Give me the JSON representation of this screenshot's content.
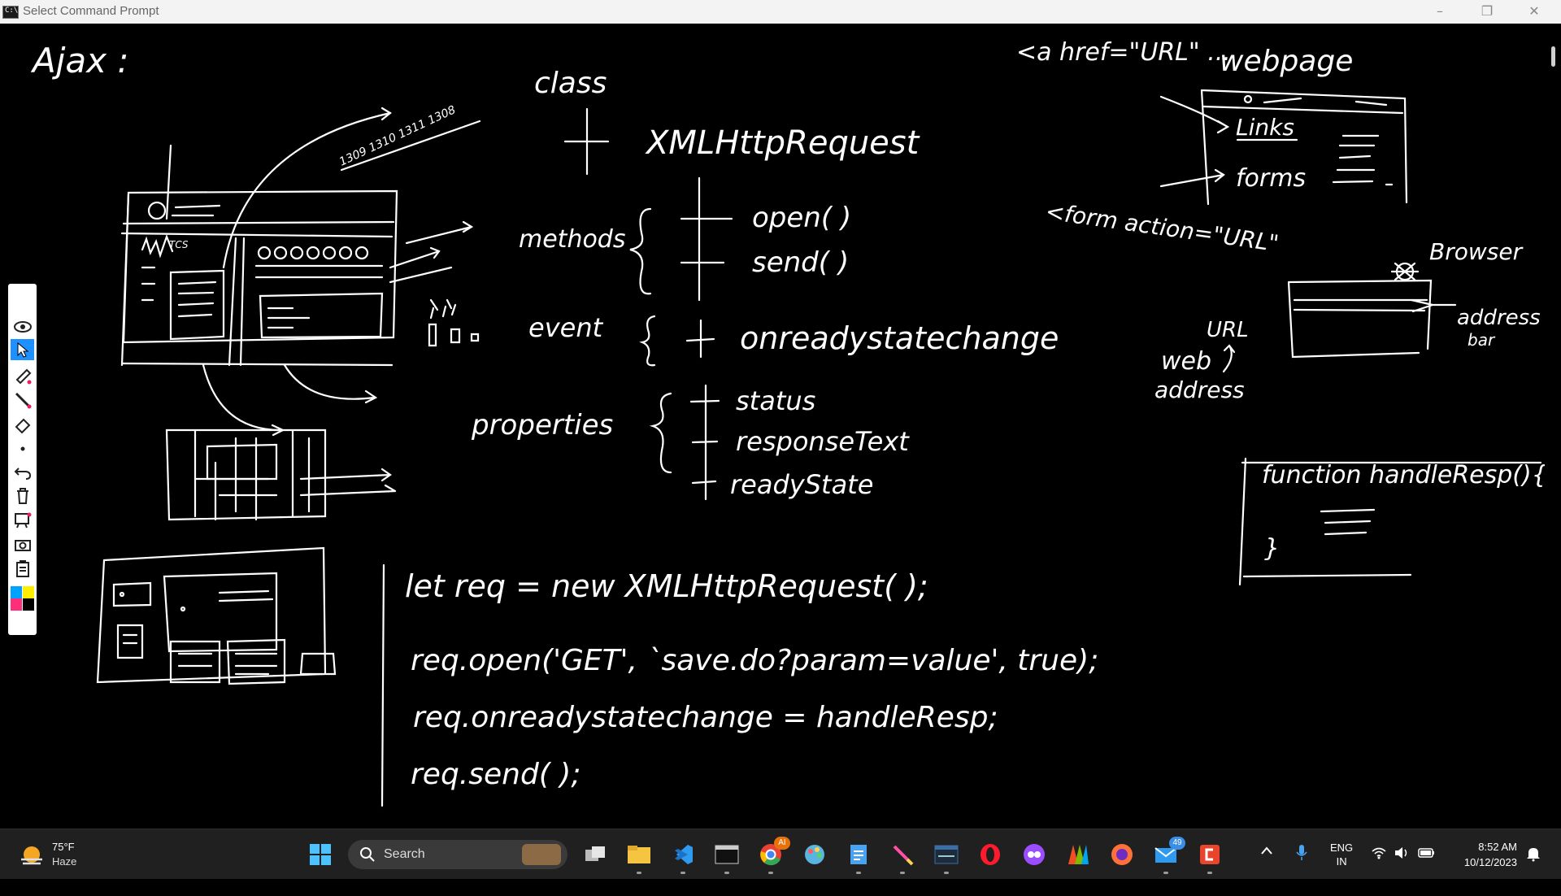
{
  "window": {
    "title": "Select Command Prompt",
    "icon_label": "C:\\",
    "buttons": [
      "minimize-icon",
      "restore-icon",
      "close-icon"
    ]
  },
  "whiteboard": {
    "heading": "Ajax :",
    "class_label": "class",
    "class_name": "XMLHttpRequest",
    "methods_label": "methods",
    "methods": [
      "open( )",
      "send( )"
    ],
    "event_label": "event",
    "event": "onreadystatechange",
    "properties_label": "properties",
    "properties": [
      "status",
      "responseText",
      "readyState"
    ],
    "code": [
      "let req  =  new  XMLHttpRequest( );",
      "req.open('GET',  `save.do?param=value',  true);",
      "req.onreadystatechange  =  handleResp;",
      "req.send( );"
    ],
    "anchor_tag": "<a href=\"URL\" ...",
    "webpage_label": "webpage",
    "links_label": "Links",
    "forms_label": "forms",
    "form_tag": "<form action=\"URL\"",
    "browser_label": "Browser",
    "url_label": "URL",
    "web_address_label": [
      "web",
      "address"
    ],
    "address_bar_label": [
      "address",
      "bar"
    ],
    "function_text": "function handleResp(){",
    "function_close": "}",
    "sketch_numbers": "1309 1310 1311 1308",
    "sketch_tcs": "TCS"
  },
  "toolbar": {
    "tools": [
      "pen-icon",
      "eye-icon",
      "pointer-icon",
      "highlighter-icon",
      "line-icon",
      "eraser-icon",
      "dot-icon",
      "undo-icon",
      "trash-icon",
      "whiteboard-icon",
      "camera-icon",
      "clipboard-icon",
      "color-palette-icon"
    ],
    "selected": "pointer-icon",
    "palette": [
      "#00a2ff",
      "#ffee00",
      "#ff2e7a",
      "#000000"
    ]
  },
  "taskbar": {
    "weather": {
      "temp": "75°F",
      "condition": "Haze"
    },
    "search_placeholder": "Search",
    "apps": [
      {
        "name": "start",
        "color": "#4cc2ff"
      },
      {
        "name": "task-view",
        "color": "#cfcfcf"
      },
      {
        "name": "file-explorer",
        "color": "#f5c542"
      },
      {
        "name": "vscode",
        "color": "#2f9bf0"
      },
      {
        "name": "terminal",
        "color": "#e0e0e0"
      },
      {
        "name": "chrome",
        "color": "#e94235"
      },
      {
        "name": "paint",
        "color": "#59b4e0"
      },
      {
        "name": "notepad",
        "color": "#4aa3f0"
      },
      {
        "name": "pen-tool",
        "color": "#ff4fa3"
      },
      {
        "name": "mysql",
        "color": "#3a6ea5"
      },
      {
        "name": "opera",
        "color": "#ff1b2d"
      },
      {
        "name": "app-purple",
        "color": "#9b4dff"
      },
      {
        "name": "app-colorful",
        "color": "#f25022"
      },
      {
        "name": "firefox",
        "color": "#ff7139"
      },
      {
        "name": "mail",
        "color": "#2f9bf0"
      },
      {
        "name": "app-red",
        "color": "#e8452c"
      }
    ],
    "chrome_badge": "AI",
    "mail_badge": "49",
    "language": [
      "ENG",
      "IN"
    ],
    "time": "8:52 AM",
    "date": "10/12/2023"
  }
}
